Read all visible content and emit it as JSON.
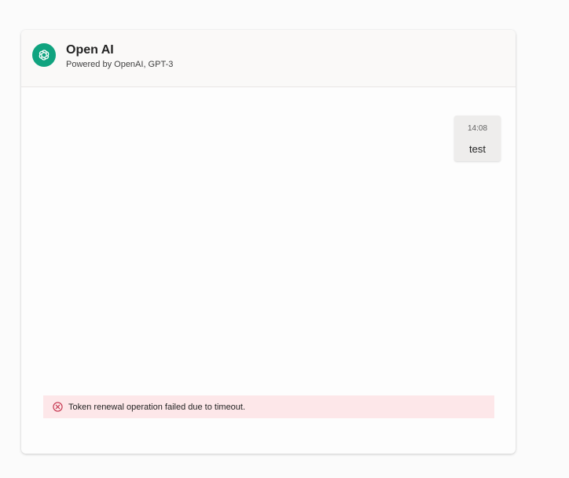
{
  "header": {
    "title": "Open AI",
    "subtitle": "Powered by OpenAI, GPT-3",
    "logo_icon": "openai-logo-icon",
    "logo_color": "#10a37f"
  },
  "messages": [
    {
      "time": "14:08",
      "text": "test"
    }
  ],
  "error": {
    "icon": "error-circle-icon",
    "text": "Token renewal operation failed due to timeout.",
    "background": "#fde7e9",
    "icon_color": "#c4314b"
  }
}
